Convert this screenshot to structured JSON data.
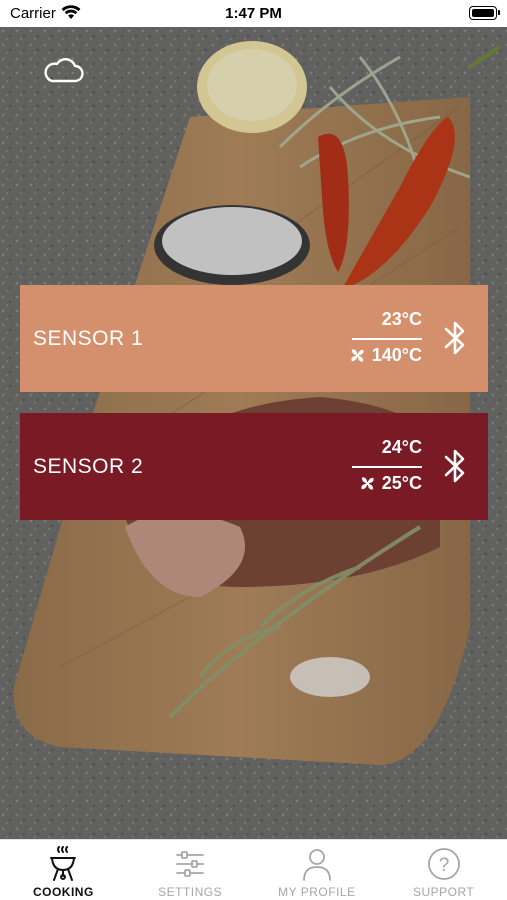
{
  "status_bar": {
    "carrier": "Carrier",
    "time": "1:47 PM"
  },
  "cloud_icon": "cloud-icon",
  "sensors": [
    {
      "label": "SENSOR 1",
      "temperature": "23°C",
      "target": "140°C",
      "color": "#d4906c",
      "status_icon": "bluetooth-icon"
    },
    {
      "label": "SENSOR 2",
      "temperature": "24°C",
      "target": "25°C",
      "color": "#7a1a24",
      "status_icon": "bluetooth-icon"
    }
  ],
  "tabs": [
    {
      "label": "COOKING",
      "icon": "grill-icon",
      "active": true
    },
    {
      "label": "SETTINGS",
      "icon": "sliders-icon",
      "active": false
    },
    {
      "label": "MY PROFILE",
      "icon": "user-icon",
      "active": false
    },
    {
      "label": "SUPPORT",
      "icon": "question-icon",
      "active": false
    }
  ]
}
